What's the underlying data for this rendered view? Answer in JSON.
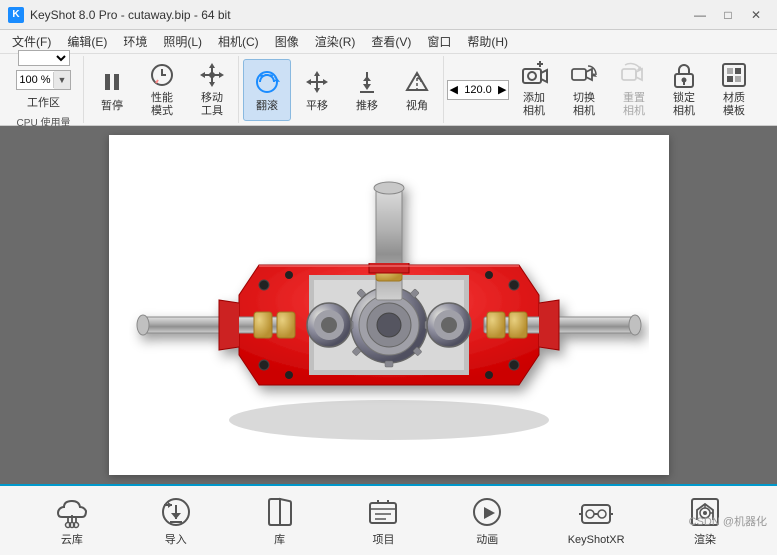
{
  "titlebar": {
    "icon_text": "K",
    "title": "KeyShot 8.0 Pro  -  cutaway.bip  -  64 bit",
    "min_btn": "—",
    "max_btn": "□",
    "close_btn": "✕"
  },
  "menubar": {
    "items": [
      "文件(F)",
      "编辑(E)",
      "环境",
      "照明(L)",
      "相机(C)",
      "图像",
      "渲染(R)",
      "查看(V)",
      "窗口",
      "帮助(H)"
    ]
  },
  "toolbar": {
    "workspace_label": "工作区",
    "zoom_value": "100 %",
    "groups": [
      {
        "id": "workspace",
        "items": []
      },
      {
        "id": "playback",
        "items": [
          {
            "id": "pause",
            "label": "暂停",
            "icon": "pause-icon"
          },
          {
            "id": "performance",
            "label": "性能\n模式",
            "icon": "performance-icon"
          },
          {
            "id": "move-tool",
            "label": "移动\n工具",
            "icon": "move-icon"
          }
        ]
      },
      {
        "id": "view",
        "items": [
          {
            "id": "tumble",
            "label": "翻滚",
            "icon": "tumble-icon",
            "active": true
          },
          {
            "id": "pan",
            "label": "平移",
            "icon": "pan-icon"
          },
          {
            "id": "push",
            "label": "推移",
            "icon": "push-icon"
          },
          {
            "id": "view-angle",
            "label": "视角",
            "icon": "view-icon"
          }
        ]
      },
      {
        "id": "camera",
        "items": [
          {
            "id": "camera-val",
            "label": "120.0",
            "icon": "camera-val-icon"
          },
          {
            "id": "add-camera",
            "label": "添加\n相机",
            "icon": "add-camera-icon"
          },
          {
            "id": "switch-camera",
            "label": "切换\n相机",
            "icon": "switch-camera-icon"
          },
          {
            "id": "reset-camera",
            "label": "重置\n相机",
            "icon": "reset-camera-icon",
            "disabled": true
          },
          {
            "id": "lock-camera",
            "label": "锁定\n相机",
            "icon": "lock-camera-icon"
          },
          {
            "id": "material-template",
            "label": "材质\n模板",
            "icon": "material-icon"
          }
        ]
      }
    ],
    "cpu_label": "CPU 使用量"
  },
  "bottom": {
    "items": [
      {
        "id": "library",
        "label": "云库",
        "icon": "cloud-icon"
      },
      {
        "id": "import",
        "label": "导入",
        "icon": "import-icon"
      },
      {
        "id": "book",
        "label": "库",
        "icon": "book-icon"
      },
      {
        "id": "project",
        "label": "项目",
        "icon": "project-icon"
      },
      {
        "id": "animation",
        "label": "动画",
        "icon": "animation-icon"
      },
      {
        "id": "keyshot-xr",
        "label": "KeyShotXR",
        "icon": "xr-icon"
      },
      {
        "id": "render",
        "label": "渲染",
        "icon": "render-icon"
      }
    ],
    "watermark": "CSDN @机器化"
  }
}
